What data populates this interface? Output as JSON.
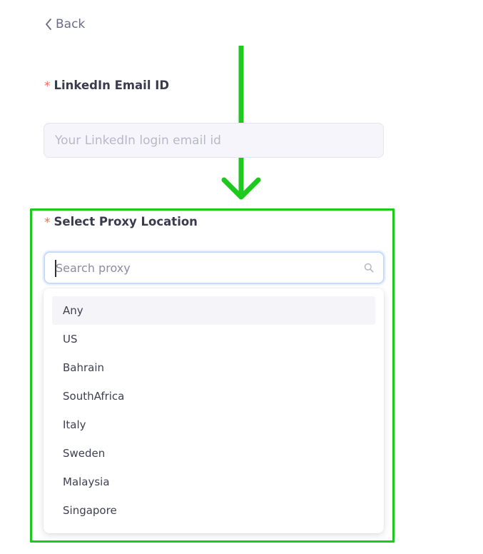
{
  "back": {
    "label": "Back"
  },
  "email_field": {
    "required_mark": "*",
    "label": "LinkedIn Email ID",
    "value": "",
    "placeholder": "Your LinkedIn login email id"
  },
  "proxy_field": {
    "required_mark": "*",
    "label": "Select Proxy Location",
    "search_value": "",
    "search_placeholder": "Search proxy",
    "options": [
      {
        "label": "Any",
        "active": true
      },
      {
        "label": "US"
      },
      {
        "label": "Bahrain"
      },
      {
        "label": "SouthAfrica"
      },
      {
        "label": "Italy"
      },
      {
        "label": "Sweden"
      },
      {
        "label": "Malaysia"
      },
      {
        "label": "Singapore"
      }
    ]
  },
  "colors": {
    "required": "#ef6a5a",
    "annotation_green": "#1dc91d",
    "focus_border": "#c7dcfb"
  },
  "icons": [
    "chevron-left-icon",
    "search-icon",
    "arrow-down-icon"
  ]
}
